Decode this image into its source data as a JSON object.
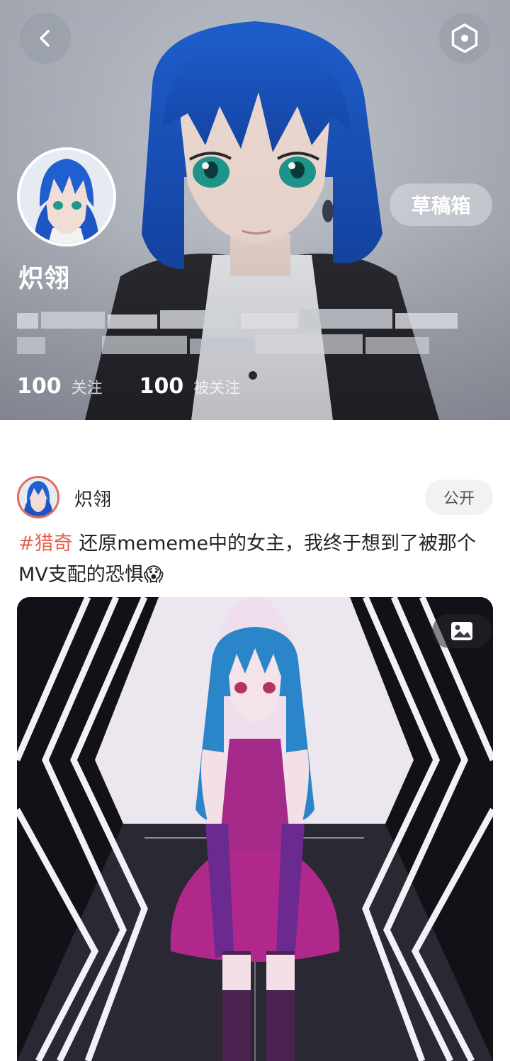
{
  "header": {
    "profile_name": "炽翎",
    "drafts_label": "草稿箱",
    "following_count": "100",
    "following_label": "关注",
    "followers_count": "100",
    "followers_label": "被关注"
  },
  "icons": {
    "back": "chevron-left-icon",
    "settings": "hexagon-settings-icon",
    "image_type": "image-icon"
  },
  "post": {
    "author": "炽翎",
    "visibility": "公开",
    "hashtag": "#猎奇",
    "text": " 还原mememe中的女主，我终于想到了被那个MV支配的恐惧😱"
  },
  "colors": {
    "hashtag": "#e8604c",
    "avatar_ring": "#e66a5b",
    "text": "#222222"
  }
}
